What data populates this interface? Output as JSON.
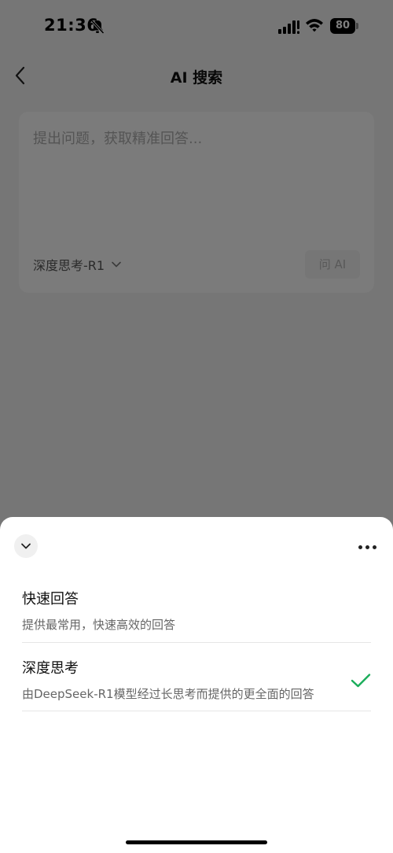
{
  "status_bar": {
    "time": "21:36",
    "battery": "80"
  },
  "nav": {
    "title": "AI 搜索",
    "back_icon": "chevron-left-icon"
  },
  "search": {
    "placeholder": "提出问题，获取精准回答...",
    "mode": "深度思考-R1",
    "ask_label": "问 AI"
  },
  "sheet": {
    "options": [
      {
        "title": "快速回答",
        "description": "提供最常用，快速高效的回答",
        "selected": false
      },
      {
        "title": "深度思考",
        "description": "由DeepSeek-R1模型经过长思考而提供的更全面的回答",
        "selected": true
      }
    ]
  },
  "colors": {
    "accent_check": "#1aad5a",
    "overlay": "rgba(0,0,0,0.5)"
  }
}
